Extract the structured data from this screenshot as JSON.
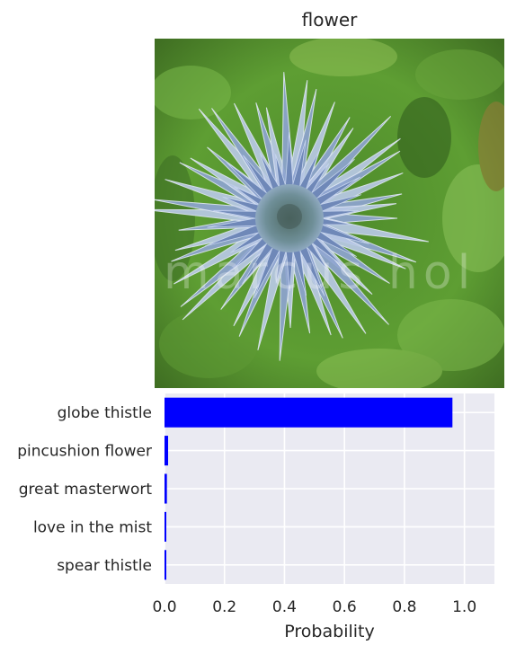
{
  "title": "flower",
  "image": {
    "watermark": "marcus hol"
  },
  "chart_data": {
    "type": "bar",
    "orientation": "horizontal",
    "categories": [
      "globe thistle",
      "pincushion flower",
      "great masterwort",
      "love in the mist",
      "spear thistle"
    ],
    "values": [
      0.96,
      0.012,
      0.008,
      0.005,
      0.004
    ],
    "xlabel": "Probability",
    "ylabel": "",
    "xlim": [
      0,
      1.1
    ],
    "xticks": [
      0.0,
      0.2,
      0.4,
      0.6,
      0.8,
      1.0
    ],
    "xtick_labels": [
      "0.0",
      "0.2",
      "0.4",
      "0.6",
      "0.8",
      "1.0"
    ],
    "bar_color": "#0000ff",
    "background_color": "#eaeaf2",
    "grid": true
  }
}
